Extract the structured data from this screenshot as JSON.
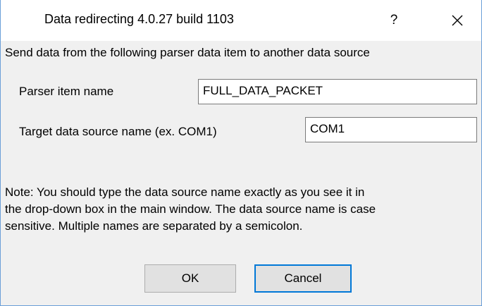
{
  "window": {
    "title": "Data redirecting 4.0.27 build 1103",
    "help_glyph": "?",
    "close_glyph": "close"
  },
  "dialog": {
    "description": "Send data from the following parser data item to another data source",
    "parser_item_label": "Parser item name",
    "parser_item_value": "FULL_DATA_PACKET",
    "target_label": "Target data source name (ex. COM1)",
    "target_value": "COM1",
    "note_lines": [
      "Note: You should type the data source name exactly as you see it in",
      "the drop-down box in the main window. The data source name is case",
      "sensitive. Multiple names are separated by a semicolon."
    ],
    "ok_label": "OK",
    "cancel_label": "Cancel"
  },
  "colors": {
    "window_border": "#6a9fd8",
    "dialog_bg": "#f0f0f0",
    "focus_accent": "#0078d7"
  }
}
